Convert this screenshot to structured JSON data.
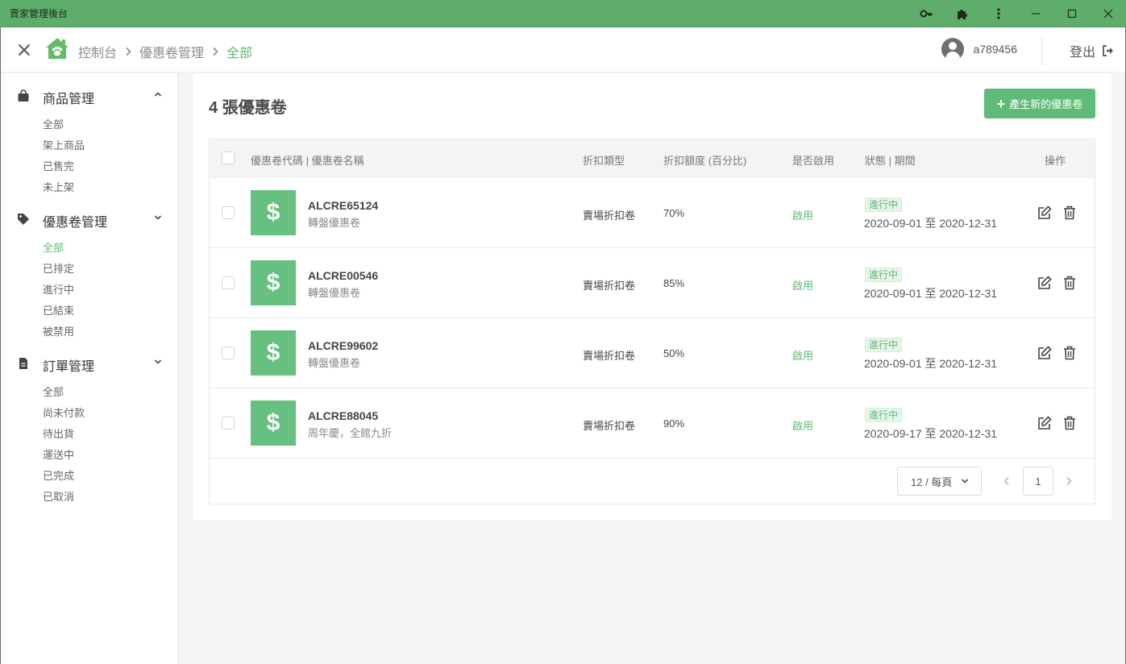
{
  "window": {
    "title": "賣家管理後台"
  },
  "breadcrumb": [
    "控制台",
    "優惠卷管理",
    "全部"
  ],
  "user": {
    "name": "a789456",
    "logout_label": "登出"
  },
  "sidebar": {
    "groups": [
      {
        "label": "商品管理",
        "icon": "shopping-bag-icon",
        "expanded": true,
        "items": [
          "全部",
          "架上商品",
          "已售完",
          "未上架"
        ]
      },
      {
        "label": "優惠卷管理",
        "icon": "tag-icon",
        "expanded": false,
        "items": [
          "全部",
          "已排定",
          "進行中",
          "已結束",
          "被禁用"
        ],
        "active_item": "全部"
      },
      {
        "label": "訂單管理",
        "icon": "document-icon",
        "expanded": false,
        "items": [
          "全部",
          "尚未付款",
          "待出貨",
          "運送中",
          "已完成",
          "已取消"
        ]
      }
    ]
  },
  "main": {
    "title": "4 張優惠卷",
    "add_button": "產生新的優惠卷"
  },
  "table": {
    "headers": {
      "code_name": "優惠卷代碼 | 優惠卷名稱",
      "type": "折扣類型",
      "amount": "折扣額度 (百分比)",
      "enabled": "是否啟用",
      "status_period": "狀態 | 期間",
      "actions": "操作"
    },
    "rows": [
      {
        "code": "ALCRE65124",
        "name": "轉盤優惠卷",
        "type": "賣場折扣卷",
        "percent": "70%",
        "enabled": "啟用",
        "status": "進行中",
        "period": "2020-09-01 至 2020-12-31"
      },
      {
        "code": "ALCRE00546",
        "name": "轉盤優惠卷",
        "type": "賣場折扣卷",
        "percent": "85%",
        "enabled": "啟用",
        "status": "進行中",
        "period": "2020-09-01 至 2020-12-31"
      },
      {
        "code": "ALCRE99602",
        "name": "轉盤優惠卷",
        "type": "賣場折扣卷",
        "percent": "50%",
        "enabled": "啟用",
        "status": "進行中",
        "period": "2020-09-01 至 2020-12-31"
      },
      {
        "code": "ALCRE88045",
        "name": "周年慶，全館九折",
        "type": "賣場折扣卷",
        "percent": "90%",
        "enabled": "啟用",
        "status": "進行中",
        "period": "2020-09-17 至 2020-12-31"
      }
    ]
  },
  "pagination": {
    "page_size": "12 / 每頁",
    "current_page": "1"
  },
  "colors": {
    "brand_green": "#5fbc78",
    "titlebar_green": "#5fad6a",
    "active_text": "#5db872"
  }
}
